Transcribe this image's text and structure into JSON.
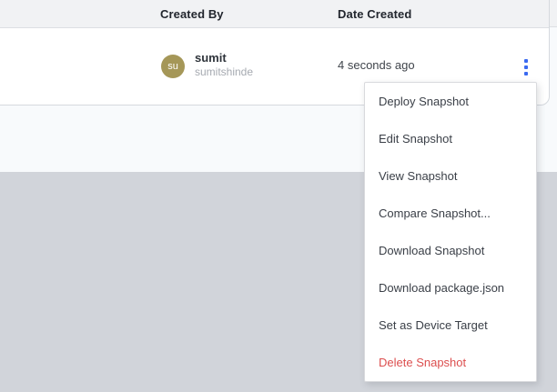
{
  "table": {
    "columns": {
      "created_by": "Created By",
      "date_created": "Date Created"
    },
    "row": {
      "avatar_initials": "su",
      "name": "sumit",
      "username": "sumitshinde",
      "date_created": "4 seconds ago"
    }
  },
  "context_menu": {
    "items": [
      {
        "label": "Deploy Snapshot"
      },
      {
        "label": "Edit Snapshot"
      },
      {
        "label": "View Snapshot"
      },
      {
        "label": "Compare Snapshot..."
      },
      {
        "label": "Download Snapshot"
      },
      {
        "label": "Download package.json"
      },
      {
        "label": "Set as Device Target"
      },
      {
        "label": "Delete Snapshot"
      }
    ]
  },
  "colors": {
    "avatar_background": "#a59758",
    "kebab_icon_blue": "#3a6af0",
    "danger_red": "#dc4f4f",
    "header_background": "#f1f2f4",
    "workspace_background": "#d1d4da"
  }
}
